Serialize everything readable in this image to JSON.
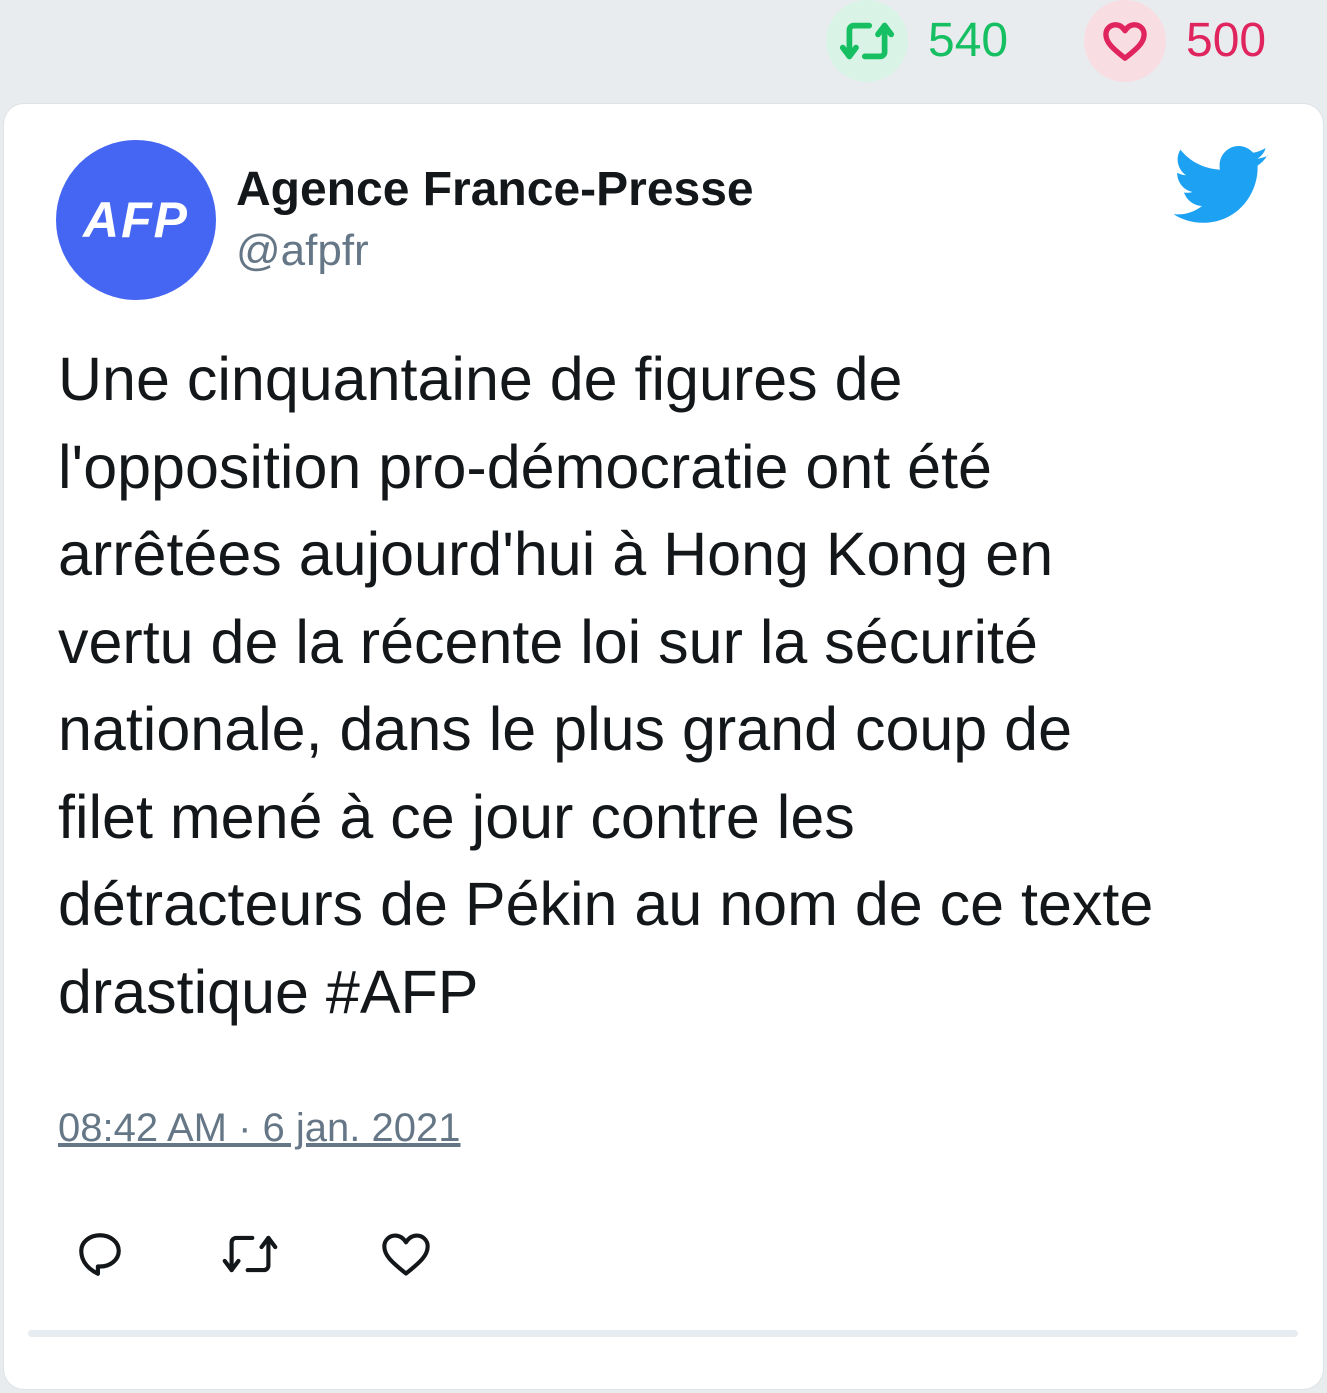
{
  "stats": {
    "retweet_count": "540",
    "like_count": "500"
  },
  "author": {
    "avatar_text": "AFP",
    "name": "Agence France-Presse",
    "handle": "@afpfr"
  },
  "tweet": {
    "text": "Une cinquantaine de figures de\nl'opposition pro-démocratie ont été\narrêtées aujourd'hui à Hong Kong en\nvertu de la récente loi sur la sécurité\nnationale, dans le plus grand coup de\nfilet mené à ce jour contre les\ndétracteurs de Pékin au nom de ce texte\ndrastique #AFP",
    "timestamp": "08:42 AM · 6 jan. 2021"
  },
  "colors": {
    "retweet_green": "#17bf63",
    "like_red": "#e0245e",
    "twitter_blue": "#1da1f2",
    "avatar_blue": "#4466f2"
  },
  "icons": {
    "retweet": "retweet-icon",
    "like": "heart-icon",
    "reply": "reply-icon",
    "brand": "twitter-bird-icon"
  }
}
